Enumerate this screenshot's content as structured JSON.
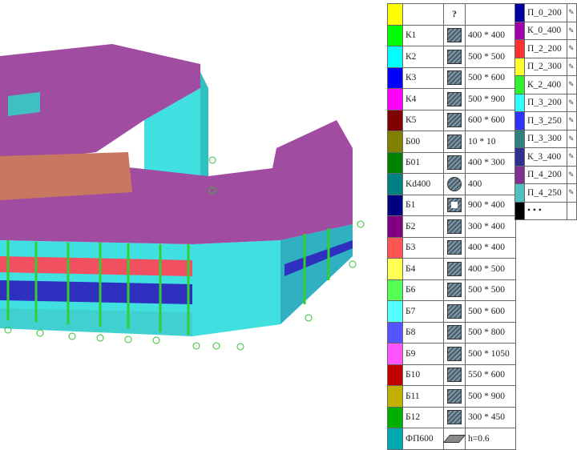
{
  "legend_left": [
    {
      "color": "#ffff00",
      "name": "",
      "icon": "question",
      "size": "?"
    },
    {
      "color": "#00ff00",
      "name": "К1",
      "icon": "hatch",
      "size": "400 * 400"
    },
    {
      "color": "#00ffff",
      "name": "К2",
      "icon": "hatch",
      "size": "500 * 500"
    },
    {
      "color": "#0000ff",
      "name": "К3",
      "icon": "hatch",
      "size": "500 * 600"
    },
    {
      "color": "#ff00ff",
      "name": "К4",
      "icon": "hatch",
      "size": "500 * 900"
    },
    {
      "color": "#800000",
      "name": "К5",
      "icon": "hatch",
      "size": "600 * 600"
    },
    {
      "color": "#808000",
      "name": "Б00",
      "icon": "hatch",
      "size": "10 * 10"
    },
    {
      "color": "#008000",
      "name": "Б01",
      "icon": "hatch",
      "size": "400 * 300"
    },
    {
      "color": "#008080",
      "name": "Kd400",
      "icon": "circle",
      "size": "400"
    },
    {
      "color": "#000080",
      "name": "Б1",
      "icon": "box",
      "size": "900  * 400"
    },
    {
      "color": "#800080",
      "name": "Б2",
      "icon": "hatch",
      "size": "300 * 400"
    },
    {
      "color": "#ff5555",
      "name": "Б3",
      "icon": "hatch",
      "size": "400 * 400"
    },
    {
      "color": "#ffff55",
      "name": "Б4",
      "icon": "hatch",
      "size": "400 * 500"
    },
    {
      "color": "#55ff55",
      "name": "Б6",
      "icon": "hatch",
      "size": "500 * 500"
    },
    {
      "color": "#55ffff",
      "name": "Б7",
      "icon": "hatch",
      "size": "500 * 600"
    },
    {
      "color": "#5555ff",
      "name": "Б8",
      "icon": "hatch",
      "size": "500 * 800"
    },
    {
      "color": "#ff55ff",
      "name": "Б9",
      "icon": "hatch",
      "size": "500 * 1050"
    },
    {
      "color": "#c00000",
      "name": "Б10",
      "icon": "hatch",
      "size": "550 * 600"
    },
    {
      "color": "#c0b000",
      "name": "Б11",
      "icon": "hatch",
      "size": "500 * 900"
    },
    {
      "color": "#00b000",
      "name": "Б12",
      "icon": "hatch",
      "size": "300 * 450"
    },
    {
      "color": "#00a8b0",
      "name": "ФП600",
      "icon": "slab",
      "size": "h=0.6"
    }
  ],
  "legend_right": [
    {
      "color": "#0000a0",
      "name": "П_0_200"
    },
    {
      "color": "#a000a8",
      "name": "К_0_400"
    },
    {
      "color": "#ff3030",
      "name": "П_2_200"
    },
    {
      "color": "#ffff30",
      "name": "П_2_300"
    },
    {
      "color": "#30f030",
      "name": "К_2_400"
    },
    {
      "color": "#30ffff",
      "name": "П_3_200"
    },
    {
      "color": "#3030ff",
      "name": "П_3_250"
    },
    {
      "color": "#308080",
      "name": "П_3_300"
    },
    {
      "color": "#303090",
      "name": "К_3_400"
    },
    {
      "color": "#803090",
      "name": "П_4_200"
    },
    {
      "color": "#50c0c0",
      "name": "П_4_250"
    },
    {
      "color": "#000000",
      "name": "• • •"
    }
  ],
  "colors": {
    "roof": "#a04ca0",
    "wall": "#40e0e0",
    "slab_red": "#f05060",
    "slab_blue": "#3030c0",
    "column": "#30d030",
    "beam": "#f0a0a0"
  }
}
